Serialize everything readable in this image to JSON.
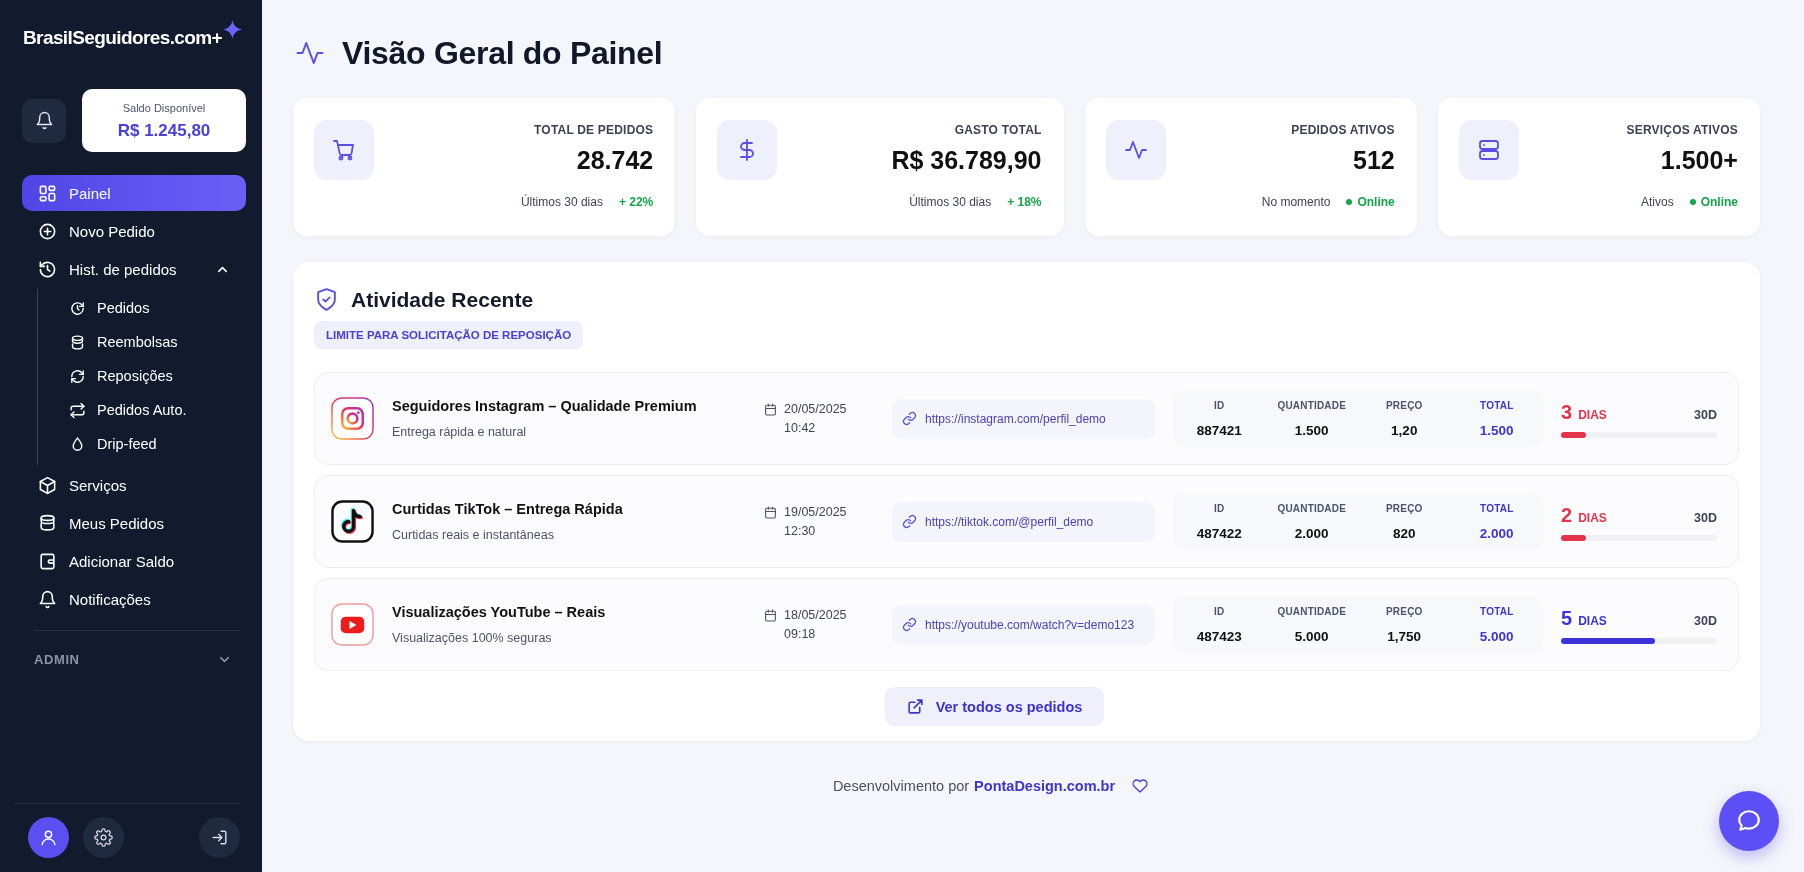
{
  "sidebar": {
    "logo": "BrasilSeguidores.com+",
    "balance": {
      "label": "Saldo Disponível",
      "value": "R$ 1.245,80"
    },
    "nav": [
      {
        "label": "Painel",
        "selected": true
      },
      {
        "label": "Novo Pedido",
        "selected": false
      },
      {
        "label": "Hist. de pedidos",
        "selected": false,
        "expanded": true,
        "children": [
          {
            "label": "Pedidos",
            "selected": false
          },
          {
            "label": "Reembolsas",
            "selected": false
          },
          {
            "label": "Reposições",
            "selected": false
          },
          {
            "label": "Pedidos Auto.",
            "selected": false
          },
          {
            "label": "Drip-feed",
            "selected": false
          }
        ]
      },
      {
        "label": "Serviços",
        "selected": false
      },
      {
        "label": "Meus Pedidos",
        "selected": false
      },
      {
        "label": "Adicionar Saldo",
        "selected": false
      },
      {
        "label": "Notificações",
        "selected": false
      }
    ],
    "sections": [
      {
        "label": "ADMIN",
        "expanded": false
      }
    ]
  },
  "page": {
    "title": "Visão Geral do Painel"
  },
  "stats": [
    {
      "label": "TOTAL DE PEDIDOS",
      "value": "28.742",
      "note": "Últimos 30 dias",
      "kind": "trend",
      "tag": "+ 22%"
    },
    {
      "label": "GASTO TOTAL",
      "value": "R$ 36.789,90",
      "note": "Últimos 30 dias",
      "kind": "trend",
      "tag": "+ 18%"
    },
    {
      "label": "PEDIDOS ATIVOS",
      "value": "512",
      "note": "No momento",
      "kind": "status",
      "tag": "Online"
    },
    {
      "label": "SERVIÇOS ATIVOS",
      "value": "1.500+",
      "note": "Ativos",
      "kind": "status",
      "tag": "Online"
    }
  ],
  "activity": {
    "title": "Atividade Recente",
    "badge": "LIMITE PARA SOLICITAÇÃO DE REPOSIÇÃO",
    "rows": [
      {
        "title": "Seguidores Instagram – Qualidade Premium",
        "subtitle": "Entrega rápida e natural",
        "date": "20/05/2025",
        "time": "10:42",
        "link": "https://instagram.com/perfil_demo",
        "fields": [
          {
            "label": "ID",
            "value": "887421",
            "kind": "plain"
          },
          {
            "label": "QUANTIDADE",
            "value": "1.500",
            "kind": "plain"
          },
          {
            "label": "PREÇO",
            "value": "1,20",
            "kind": "plain"
          },
          {
            "label": "TOTAL",
            "value": "1.500",
            "kind": "total"
          }
        ],
        "remaining": {
          "count": "3",
          "unit": "DIAS",
          "limit": "30D",
          "level": 0.16,
          "color": "#e5334b"
        }
      },
      {
        "title": "Curtidas TikTok – Entrega Rápida",
        "subtitle": "Curtidas reais e instantâneas",
        "date": "19/05/2025",
        "time": "12:30",
        "link": "https://tiktok.com/@perfil_demo",
        "fields": [
          {
            "label": "ID",
            "value": "487422",
            "kind": "plain"
          },
          {
            "label": "QUANTIDADE",
            "value": "2.000",
            "kind": "plain"
          },
          {
            "label": "PREÇO",
            "value": "820",
            "kind": "plain"
          },
          {
            "label": "TOTAL",
            "value": "2.000",
            "kind": "total"
          }
        ],
        "remaining": {
          "count": "2",
          "unit": "DIAS",
          "limit": "30D",
          "level": 0.16,
          "color": "#e5334b"
        }
      },
      {
        "title": "Visualizações YouTube – Reais",
        "subtitle": "Visualizações 100% seguras",
        "date": "18/05/2025",
        "time": "09:18",
        "link": "https://youtube.com/watch?v=demo123",
        "fields": [
          {
            "label": "ID",
            "value": "487423",
            "kind": "plain"
          },
          {
            "label": "QUANTIDADE",
            "value": "5.000",
            "kind": "plain"
          },
          {
            "label": "PREÇO",
            "value": "1,750",
            "kind": "plain"
          },
          {
            "label": "TOTAL",
            "value": "5.000",
            "kind": "total"
          }
        ],
        "remaining": {
          "count": "5",
          "unit": "DIAS",
          "limit": "30D",
          "level": 0.6,
          "color": "#3b32d9"
        }
      }
    ],
    "button": "Ver todos os pedidos"
  },
  "footer": {
    "text": "Desenvolvimento por",
    "link": "PontaDesign.com.br"
  }
}
